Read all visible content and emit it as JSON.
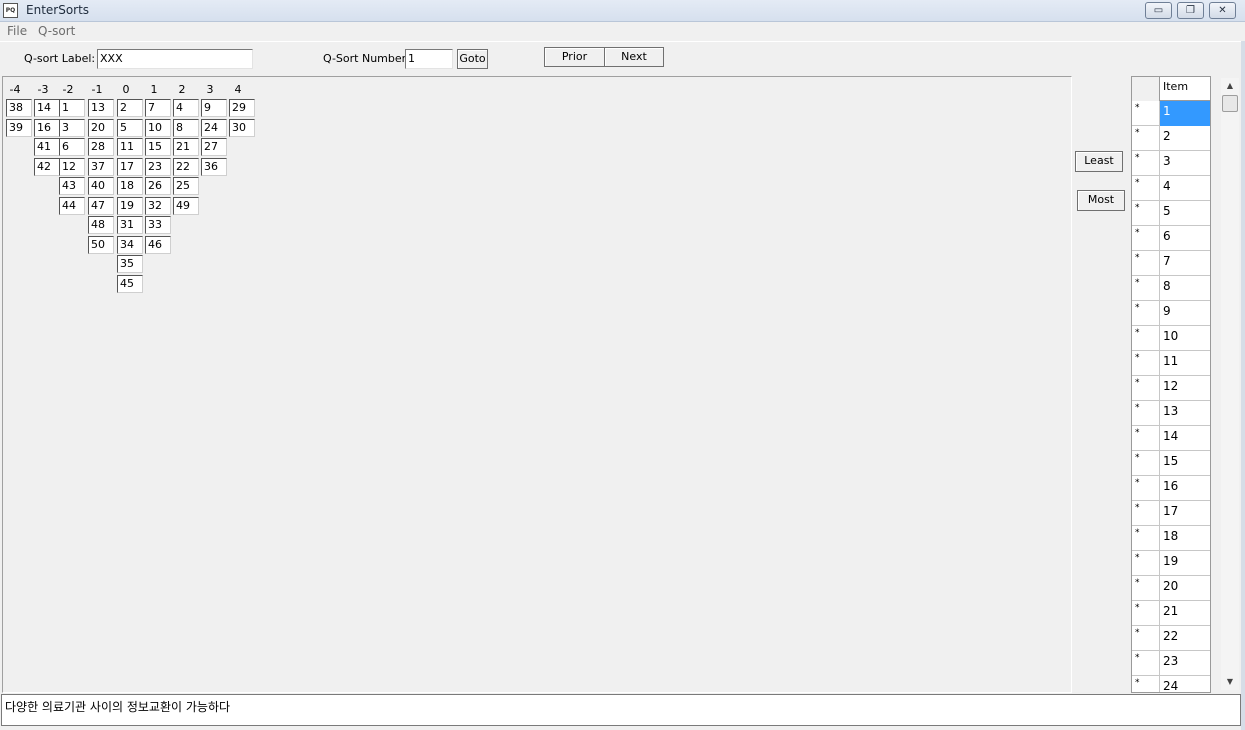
{
  "window": {
    "title": "EnterSorts",
    "icon_text": "PQ"
  },
  "window_controls": {
    "minimize": "▭",
    "restore": "❐",
    "close": "✕"
  },
  "menu": {
    "items": [
      "File",
      "Q-sort"
    ]
  },
  "toolbar": {
    "qsort_label_caption": "Q-sort Label:",
    "qsort_label_value": "XXX",
    "qsort_number_caption": "Q-Sort Number:",
    "qsort_number_value": "1",
    "goto_label": "Goto",
    "prior_label": "Prior",
    "next_label": "Next"
  },
  "sort_grid": {
    "columns": [
      {
        "header": "-4",
        "items": [
          "38",
          "39"
        ]
      },
      {
        "header": "-3",
        "items": [
          "14",
          "16",
          "41",
          "42"
        ]
      },
      {
        "header": "-2",
        "items": [
          "1",
          "3",
          "6",
          "12",
          "43",
          "44"
        ]
      },
      {
        "header": "-1",
        "items": [
          "13",
          "20",
          "28",
          "37",
          "40",
          "47",
          "48",
          "50"
        ]
      },
      {
        "header": "0",
        "items": [
          "2",
          "5",
          "11",
          "17",
          "18",
          "19",
          "31",
          "34",
          "35",
          "45"
        ]
      },
      {
        "header": "1",
        "items": [
          "7",
          "10",
          "15",
          "23",
          "26",
          "32",
          "33",
          "46"
        ]
      },
      {
        "header": "2",
        "items": [
          "4",
          "8",
          "21",
          "22",
          "25",
          "49"
        ]
      },
      {
        "header": "3",
        "items": [
          "9",
          "24",
          "27",
          "36"
        ]
      },
      {
        "header": "4",
        "items": [
          "29",
          "30"
        ]
      }
    ]
  },
  "side_buttons": {
    "least_label": "Least",
    "most_label": "Most"
  },
  "item_list": {
    "header": "Item",
    "selected_value": "1",
    "rows": [
      {
        "mark": "*",
        "value": "1"
      },
      {
        "mark": "*",
        "value": "2"
      },
      {
        "mark": "*",
        "value": "3"
      },
      {
        "mark": "*",
        "value": "4"
      },
      {
        "mark": "*",
        "value": "5"
      },
      {
        "mark": "*",
        "value": "6"
      },
      {
        "mark": "*",
        "value": "7"
      },
      {
        "mark": "*",
        "value": "8"
      },
      {
        "mark": "*",
        "value": "9"
      },
      {
        "mark": "*",
        "value": "10"
      },
      {
        "mark": "*",
        "value": "11"
      },
      {
        "mark": "*",
        "value": "12"
      },
      {
        "mark": "*",
        "value": "13"
      },
      {
        "mark": "*",
        "value": "14"
      },
      {
        "mark": "*",
        "value": "15"
      },
      {
        "mark": "*",
        "value": "16"
      },
      {
        "mark": "*",
        "value": "17"
      },
      {
        "mark": "*",
        "value": "18"
      },
      {
        "mark": "*",
        "value": "19"
      },
      {
        "mark": "*",
        "value": "20"
      },
      {
        "mark": "*",
        "value": "21"
      },
      {
        "mark": "*",
        "value": "22"
      },
      {
        "mark": "*",
        "value": "23"
      },
      {
        "mark": "*",
        "value": "24"
      }
    ]
  },
  "scrollbar": {
    "up_arrow": "▲",
    "down_arrow": "▼"
  },
  "statement": {
    "text": "다양한 의료기관 사이의 정보교환이 가능하다"
  }
}
